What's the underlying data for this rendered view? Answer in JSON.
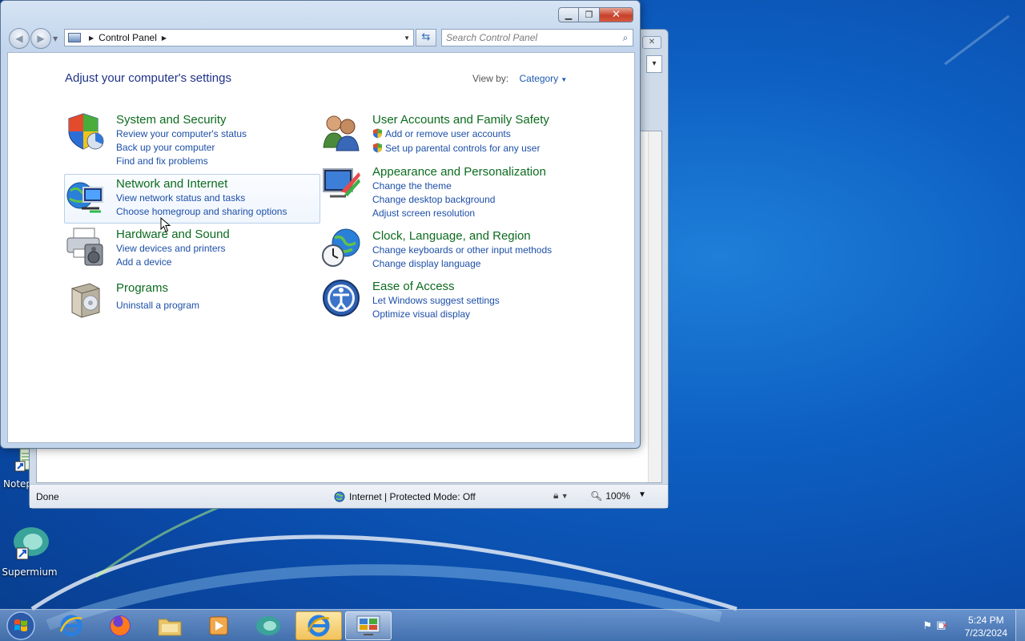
{
  "control_panel": {
    "address": {
      "items": [
        "Control Panel"
      ]
    },
    "search": {
      "placeholder": "Search Control Panel"
    },
    "title": "Adjust your computer's settings",
    "view_by": {
      "label": "View by:",
      "value": "Category"
    },
    "categories": [
      {
        "heading": "System and Security",
        "links": [
          "Review your computer's status",
          "Back up your computer",
          "Find and fix problems"
        ]
      },
      {
        "heading": "Network and Internet",
        "links": [
          "View network status and tasks",
          "Choose homegroup and sharing options"
        ]
      },
      {
        "heading": "Hardware and Sound",
        "links": [
          "View devices and printers",
          "Add a device"
        ]
      },
      {
        "heading": "Programs",
        "links": [
          "Uninstall a program"
        ]
      },
      {
        "heading": "User Accounts and Family Safety",
        "links": [
          "Add or remove user accounts",
          "Set up parental controls for any user"
        ]
      },
      {
        "heading": "Appearance and Personalization",
        "links": [
          "Change the theme",
          "Change desktop background",
          "Adjust screen resolution"
        ]
      },
      {
        "heading": "Clock, Language, and Region",
        "links": [
          "Change keyboards or other input methods",
          "Change display language"
        ]
      },
      {
        "heading": "Ease of Access",
        "links": [
          "Let Windows suggest settings",
          "Optimize visual display"
        ]
      }
    ]
  },
  "ie_window": {
    "status": "Done",
    "zone": "Internet | Protected Mode: Off",
    "zoom": "100%"
  },
  "desktop": {
    "icons": [
      {
        "label": "Notep",
        "icon": "notepad-shortcut-icon"
      },
      {
        "label": "Supermium",
        "icon": "supermium-shortcut-icon"
      }
    ]
  },
  "taskbar": {
    "items": [
      "start-orb",
      "internet-explorer",
      "firefox",
      "file-explorer",
      "media-player",
      "supermium",
      "internet-explorer-active",
      "control-panel-active"
    ],
    "clock": {
      "time": "5:24 PM",
      "date": "7/23/2024"
    }
  },
  "colors": {
    "heading_green": "#0d6b1f",
    "link_blue": "#1d4fa8",
    "title_blue": "#1e3287",
    "close_red": "#c7412b"
  }
}
